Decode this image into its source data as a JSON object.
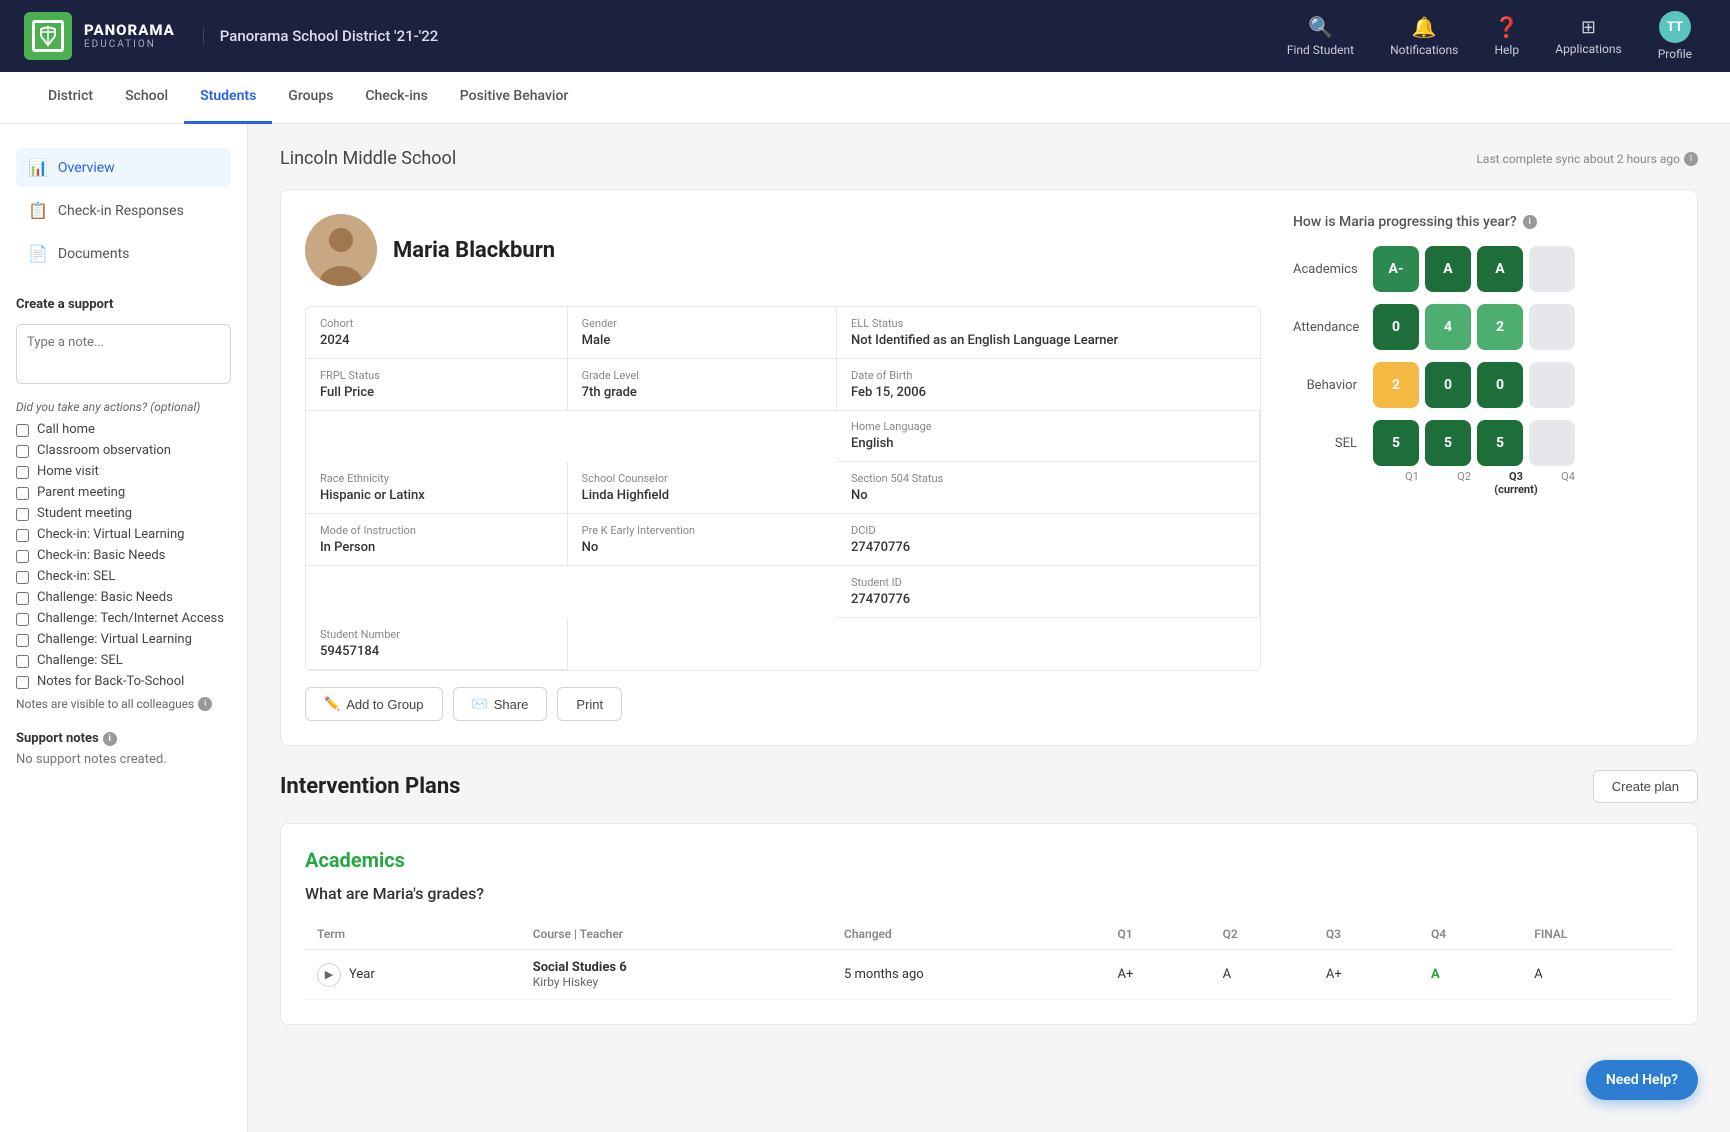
{
  "app": {
    "brand": "PANORAMA",
    "brand_sub": "EDUCATION",
    "district": "Panorama School District '21-'22",
    "avatar_initials": "TT"
  },
  "nav_actions": [
    {
      "id": "find-student",
      "icon": "🔍",
      "label": "Find Student"
    },
    {
      "id": "notifications",
      "icon": "🔔",
      "label": "Notifications"
    },
    {
      "id": "help",
      "icon": "❓",
      "label": "Help"
    },
    {
      "id": "applications",
      "icon": "⊞",
      "label": "Applications"
    },
    {
      "id": "profile",
      "icon": "TT",
      "label": "Profile",
      "is_avatar": true
    }
  ],
  "sub_nav": {
    "items": [
      {
        "id": "district",
        "label": "District",
        "active": false
      },
      {
        "id": "school",
        "label": "School",
        "active": false
      },
      {
        "id": "students",
        "label": "Students",
        "active": true
      },
      {
        "id": "groups",
        "label": "Groups",
        "active": false
      },
      {
        "id": "check-ins",
        "label": "Check-ins",
        "active": false
      },
      {
        "id": "positive-behavior",
        "label": "Positive Behavior",
        "active": false
      }
    ]
  },
  "sidebar": {
    "nav": [
      {
        "id": "overview",
        "icon": "📊",
        "label": "Overview",
        "active": true
      },
      {
        "id": "check-in-responses",
        "icon": "📋",
        "label": "Check-in Responses",
        "active": false
      },
      {
        "id": "documents",
        "icon": "📄",
        "label": "Documents",
        "active": false
      }
    ],
    "create_support": {
      "title": "Create a support",
      "placeholder": "Type a note...",
      "actions_label": "Did you take any actions? (optional)",
      "checkboxes": [
        "Call home",
        "Classroom observation",
        "Home visit",
        "Parent meeting",
        "Student meeting",
        "Check-in: Virtual Learning",
        "Check-in: Basic Needs",
        "Check-in: SEL",
        "Challenge: Basic Needs",
        "Challenge: Tech/Internet Access",
        "Challenge: Virtual Learning",
        "Challenge: SEL",
        "Notes for Back-To-School"
      ],
      "notes_visible": "Notes are visible to all colleagues"
    },
    "support_notes": {
      "title": "Support notes",
      "empty_text": "No support notes created."
    }
  },
  "content": {
    "school_name": "Lincoln Middle School",
    "sync_info": "Last complete sync about 2 hours ago",
    "student": {
      "name": "Maria Blackburn",
      "cohort_label": "Cohort",
      "cohort": "2024",
      "gender_label": "Gender",
      "gender": "Male",
      "ell_status_label": "ELL Status",
      "ell_status": "Not Identified as an English Language Learner",
      "frpl_status_label": "FRPL Status",
      "frpl_status": "Full Price",
      "grade_level_label": "Grade Level",
      "grade_level": "7th grade",
      "dob_label": "Date of Birth",
      "dob": "Feb 15, 2006",
      "home_lang_label": "Home Language",
      "home_lang": "English",
      "race_label": "Race Ethnicity",
      "race": "Hispanic or Latinx",
      "counselor_label": "School Counselor",
      "counselor": "Linda Highfield",
      "section504_label": "Section 504 Status",
      "section504": "No",
      "mode_label": "Mode of Instruction",
      "mode": "In Person",
      "prek_label": "Pre K Early Intervention",
      "prek": "No",
      "dcid_label": "DCID",
      "dcid": "27470776",
      "student_id_label": "Student ID",
      "student_id": "27470776",
      "student_number_label": "Student Number",
      "student_number": "59457184"
    },
    "actions": {
      "add_to_group": "Add to Group",
      "share": "Share",
      "print": "Print"
    },
    "progress": {
      "title": "How is Maria progressing this year?",
      "rows": [
        {
          "label": "Academics",
          "quarters": [
            {
              "value": "A-",
              "style": "green"
            },
            {
              "value": "A",
              "style": "dark-green"
            },
            {
              "value": "A",
              "style": "dark-green"
            },
            {
              "value": "",
              "style": "gray"
            }
          ]
        },
        {
          "label": "Attendance",
          "quarters": [
            {
              "value": "0",
              "style": "dark-green"
            },
            {
              "value": "4",
              "style": "light-green"
            },
            {
              "value": "2",
              "style": "light-green"
            },
            {
              "value": "",
              "style": "gray"
            }
          ]
        },
        {
          "label": "Behavior",
          "quarters": [
            {
              "value": "2",
              "style": "yellow"
            },
            {
              "value": "0",
              "style": "dark-green"
            },
            {
              "value": "0",
              "style": "dark-green"
            },
            {
              "value": "",
              "style": "gray"
            }
          ]
        },
        {
          "label": "SEL",
          "quarters": [
            {
              "value": "5",
              "style": "dark-green"
            },
            {
              "value": "5",
              "style": "dark-green"
            },
            {
              "value": "5",
              "style": "dark-green"
            },
            {
              "value": "",
              "style": "gray"
            }
          ]
        }
      ],
      "quarter_labels": [
        {
          "label": "Q1",
          "current": false
        },
        {
          "label": "Q2",
          "current": false
        },
        {
          "label": "Q3\n(current)",
          "current": true
        },
        {
          "label": "Q4",
          "current": false
        }
      ]
    },
    "intervention": {
      "title": "Intervention Plans",
      "create_btn": "Create plan",
      "academics_title": "Academics",
      "grades_question": "What are Maria's grades?",
      "table": {
        "headers": [
          "Term",
          "Course | Teacher",
          "Changed",
          "Q1",
          "Q2",
          "Q3",
          "Q4",
          "FINAL"
        ],
        "rows": [
          {
            "expand": true,
            "term": "Year",
            "course": "Social Studies 6",
            "teacher": "Kirby Hiskey",
            "changed": "5 months ago",
            "q1": "A+",
            "q2": "A",
            "q3": "A+",
            "q4": "A",
            "q4_current": true,
            "final": "A"
          }
        ]
      }
    }
  },
  "need_help_label": "Need Help?"
}
